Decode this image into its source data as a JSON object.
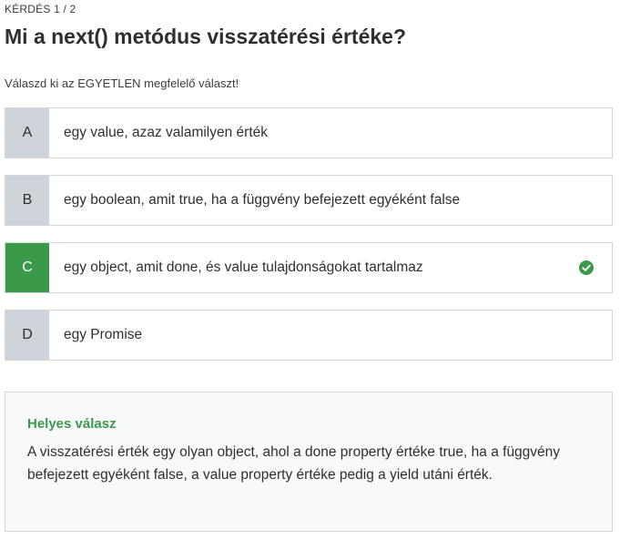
{
  "header": {
    "counter": "KÉRDÉS 1 / 2",
    "title": "Mi a next() metódus visszatérési értéke?",
    "instruction": "Válaszd ki az EGYETLEN megfelelő választ!"
  },
  "answers": [
    {
      "letter": "A",
      "text": "egy value, azaz valamilyen érték",
      "correct": false
    },
    {
      "letter": "B",
      "text": "egy boolean, amit true, ha a függvény befejezett egyéként false",
      "correct": false
    },
    {
      "letter": "C",
      "text": "egy object, amit done, és value tulajdonságokat tartalmaz",
      "correct": true
    },
    {
      "letter": "D",
      "text": "egy Promise",
      "correct": false
    }
  ],
  "explanation": {
    "title": "Helyes válasz",
    "body": "A visszatérési érték egy olyan object, ahol a done property értéke true, ha a függvény befejezett egyéként false, a value property értéke pedig a yield utáni érték."
  },
  "icons": {
    "correct": "check-circle-icon"
  },
  "colors": {
    "correct_green": "#3b9a4a",
    "letter_gray": "#cfd3da",
    "border": "#d1d7dc",
    "explanation_bg": "#f7f9fa"
  }
}
